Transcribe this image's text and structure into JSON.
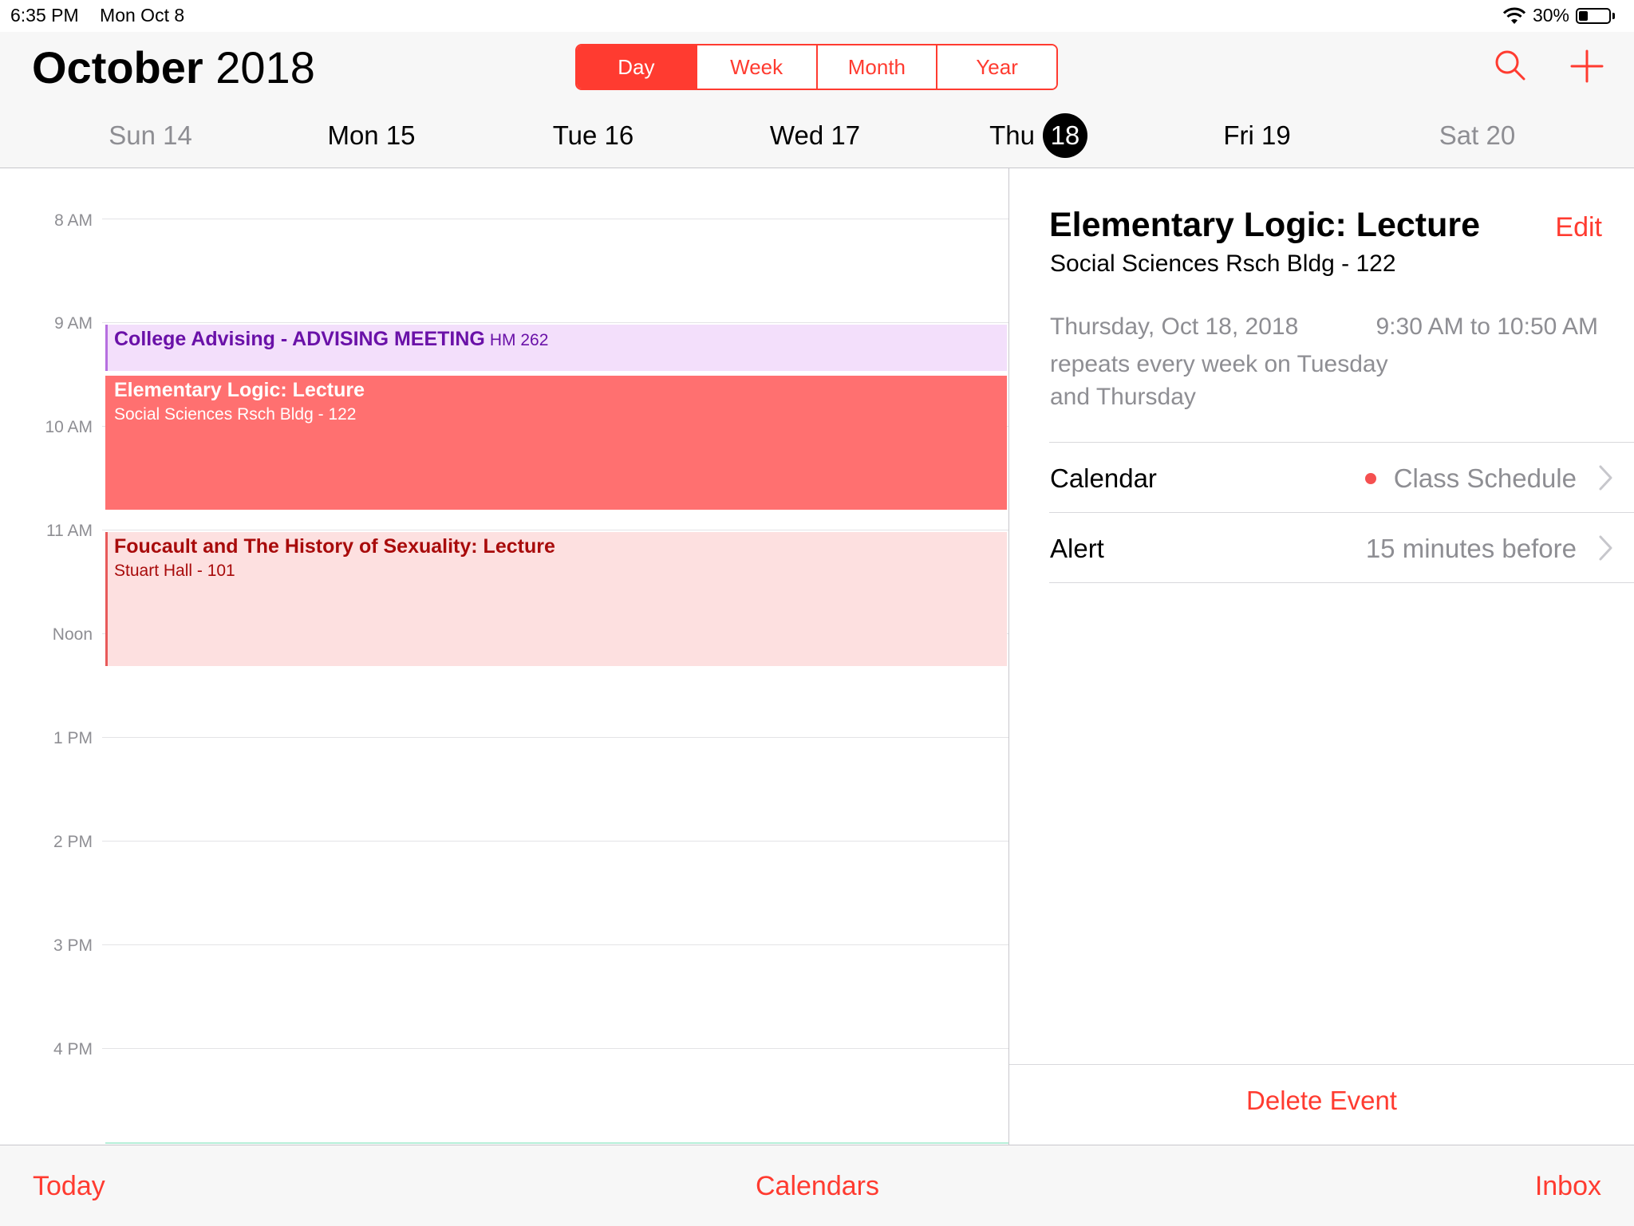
{
  "status_bar": {
    "time": "6:35 PM",
    "date": "Mon Oct 8",
    "battery": "30%",
    "battery_fraction": 0.3
  },
  "header": {
    "month": "October",
    "year": "2018",
    "segments": [
      "Day",
      "Week",
      "Month",
      "Year"
    ],
    "active_segment": "Day",
    "accent_color": "#ff3b30"
  },
  "week": {
    "days": [
      {
        "label": "Sun 14"
      },
      {
        "label": "Mon 15"
      },
      {
        "label": "Tue 16"
      },
      {
        "label": "Wed 17"
      },
      {
        "label": "Thu",
        "num": "18"
      },
      {
        "label": "Fri 19"
      },
      {
        "label": "Sat 20"
      }
    ]
  },
  "timeline": {
    "hours": [
      "8 AM",
      "9 AM",
      "10 AM",
      "11 AM",
      "Noon",
      "1 PM",
      "2 PM",
      "3 PM",
      "4 PM"
    ],
    "events": [
      {
        "title": "College Advising - ADVISING MEETING",
        "location": "HM 262"
      },
      {
        "title": "Elementary Logic: Lecture",
        "location": "Social Sciences Rsch Bldg - 122"
      },
      {
        "title": "Foucault and The History of Sexuality: Lecture",
        "location": "Stuart Hall - 101"
      }
    ]
  },
  "detail": {
    "title": "Elementary Logic: Lecture",
    "edit_label": "Edit",
    "location": "Social Sciences Rsch Bldg - 122",
    "date": "Thursday, Oct 18, 2018",
    "time": "9:30 AM to 10:50 AM",
    "repeat": "repeats every week on Tuesday and Thursday",
    "calendar_label": "Calendar",
    "calendar_value": "Class Schedule",
    "calendar_color": "#f55050",
    "alert_label": "Alert",
    "alert_value": "15 minutes before",
    "delete_label": "Delete Event"
  },
  "toolbar": {
    "today": "Today",
    "calendars": "Calendars",
    "inbox": "Inbox"
  }
}
